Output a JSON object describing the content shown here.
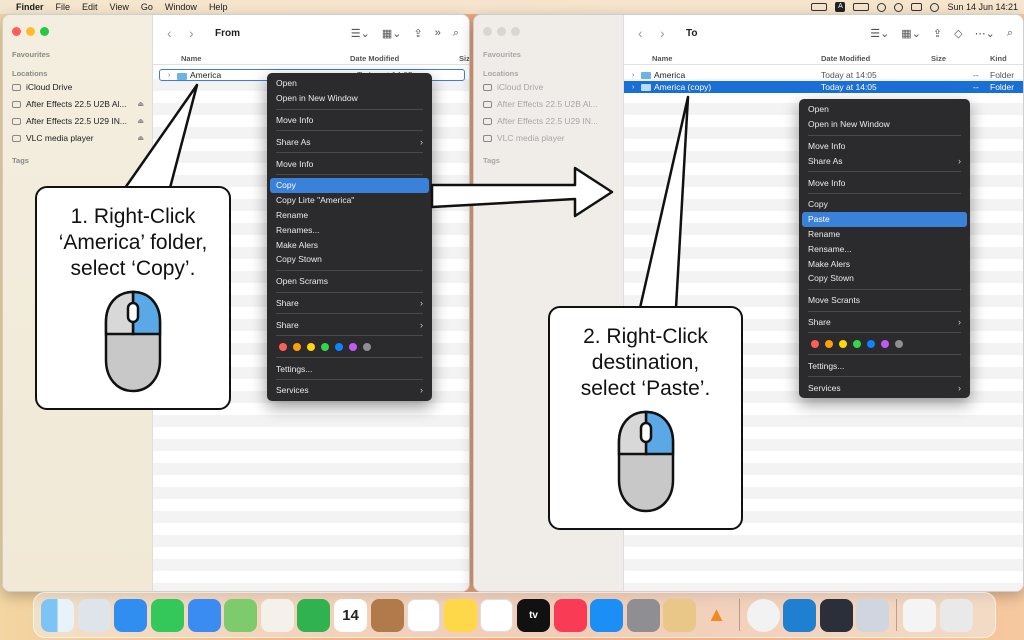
{
  "menubar": {
    "app_name": "Finder",
    "menus": [
      "File",
      "Edit",
      "View",
      "Go",
      "Window",
      "Help"
    ],
    "status_icons": [
      "battery-status-icon",
      "text-input-icon",
      "toggle-icon",
      "wifi-icon",
      "search-icon",
      "control-center-icon",
      "siri-icon"
    ],
    "datetime": "Sun 14 Jun  14:21"
  },
  "left_window": {
    "title": "From",
    "sidebar": {
      "favourites_label": "Favourites",
      "locations_label": "Locations",
      "tags_label": "Tags",
      "items": [
        "iCloud Drive",
        "After Effects 22.5 U2B Al...",
        "After Effects 22.5 U29 IN...",
        "VLC media player"
      ]
    },
    "columns": {
      "name": "Name",
      "date": "Date Modified",
      "size": "Size"
    },
    "rows": [
      {
        "name": "America",
        "date": "Today at 14:05"
      }
    ]
  },
  "right_window": {
    "title": "To",
    "sidebar": {
      "favourites_label": "Favourites",
      "locations_label": "Locations",
      "tags_label": "Tags",
      "items": [
        "iCloud Drive",
        "After Effects 22.5 U2B Al...",
        "After Effects 22.5 U29 IN...",
        "VLC media player"
      ]
    },
    "columns": {
      "name": "Name",
      "date": "Date Modified",
      "size": "Size",
      "kind": "Kind"
    },
    "rows": [
      {
        "name": "America",
        "date": "Today at 14:05",
        "size": "--",
        "kind": "Folder"
      },
      {
        "name": "America (copy)",
        "date": "Today at 14:05",
        "size": "--",
        "kind": "Folder"
      }
    ]
  },
  "left_menu": {
    "items": [
      "Open",
      "Open in New Window",
      "Move Info",
      "Share As",
      "Move Info",
      "Copy",
      "Copy Lirte \"America\"",
      "Rename",
      "Renames...",
      "Make Alers",
      "Copy Stown",
      "Open Scrams",
      "Share",
      "Share",
      "Tettings...",
      "Services"
    ],
    "highlighted": "Copy"
  },
  "right_menu": {
    "items": [
      "Open",
      "Open in New Window",
      "Move Info",
      "Share As",
      "Move Info",
      "Copy",
      "Paste",
      "Rename",
      "Rensame...",
      "Make Alers",
      "Copy Stown",
      "Move Scrants",
      "Share",
      "Tettings...",
      "Services"
    ],
    "highlighted": "Paste"
  },
  "tag_colors": [
    "#ff5f57",
    "#ff9f0a",
    "#ffd60a",
    "#32d74b",
    "#0a84ff",
    "#bf5af2",
    "#8e8e93"
  ],
  "callout_left": {
    "line1": "1. Right-Click",
    "line2": "‘America’ folder,",
    "line3": "select ‘Copy’."
  },
  "callout_right": {
    "line1": "2. Right-Click",
    "line2": "destination,",
    "line3": "select ‘Paste’."
  },
  "dock": {
    "calendar_day": "14",
    "tv_label": "tv",
    "icons": [
      "finder-icon",
      "launchpad-icon",
      "safari-icon",
      "messages-icon",
      "mail-icon",
      "maps-icon",
      "photos-icon",
      "facetime-icon",
      "calendar-icon",
      "contacts-icon",
      "reminders-icon",
      "notes-icon",
      "freeform-icon",
      "apple-tv-icon",
      "music-icon",
      "app-store-icon",
      "system-settings-icon",
      "preview-icon",
      "vlc-icon",
      "chrome-icon",
      "vscode-icon",
      "quicktime-icon",
      "printer-icon",
      "downloads-icon",
      "trash-icon"
    ]
  }
}
